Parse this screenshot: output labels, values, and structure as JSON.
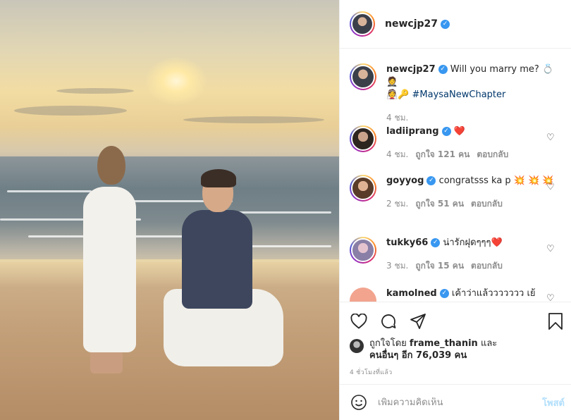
{
  "post": {
    "owner": "newcjp27",
    "caption_prefix": "Will you marry me? 💍🤵",
    "caption_tag_emojis": "👰🔑",
    "caption_hashtag": "#MaysaNewChapter",
    "caption_time": "4 ชม."
  },
  "comments": [
    {
      "user": "ladiiprang",
      "text": "❤️",
      "time": "4 ชม.",
      "likes": "ถูกใจ 121 คน",
      "reply": "ตอบกลับ"
    },
    {
      "user": "goyyog",
      "text": "congratsss ka p 💥 💥 💥",
      "time": "2 ชม.",
      "likes": "ถูกใจ 51 คน",
      "reply": "ตอบกลับ"
    },
    {
      "user": "tukky66",
      "text": "น่ารักฝุดๆๆๆ❤️",
      "time": "3 ชม.",
      "likes": "ถูกใจ 15 คน",
      "reply": "ตอบกลับ"
    },
    {
      "user": "kamolned",
      "text": "เค้าว่าแล้ววววววว เย้"
    }
  ],
  "likes": {
    "prefix": "ถูกใจโดย",
    "user": "frame_thanin",
    "middle": "และ",
    "others": "คนอื่นๆ อีก 76,039 คน"
  },
  "timestamp": "4 ชั่วโมงที่แล้ว",
  "add_comment": {
    "placeholder": "เพิ่มความคิดเห็น",
    "post_label": "โพสต์"
  },
  "icons": [
    "heart-icon",
    "comment-icon",
    "share-icon",
    "bookmark-icon",
    "emoji-icon",
    "verified-icon"
  ]
}
